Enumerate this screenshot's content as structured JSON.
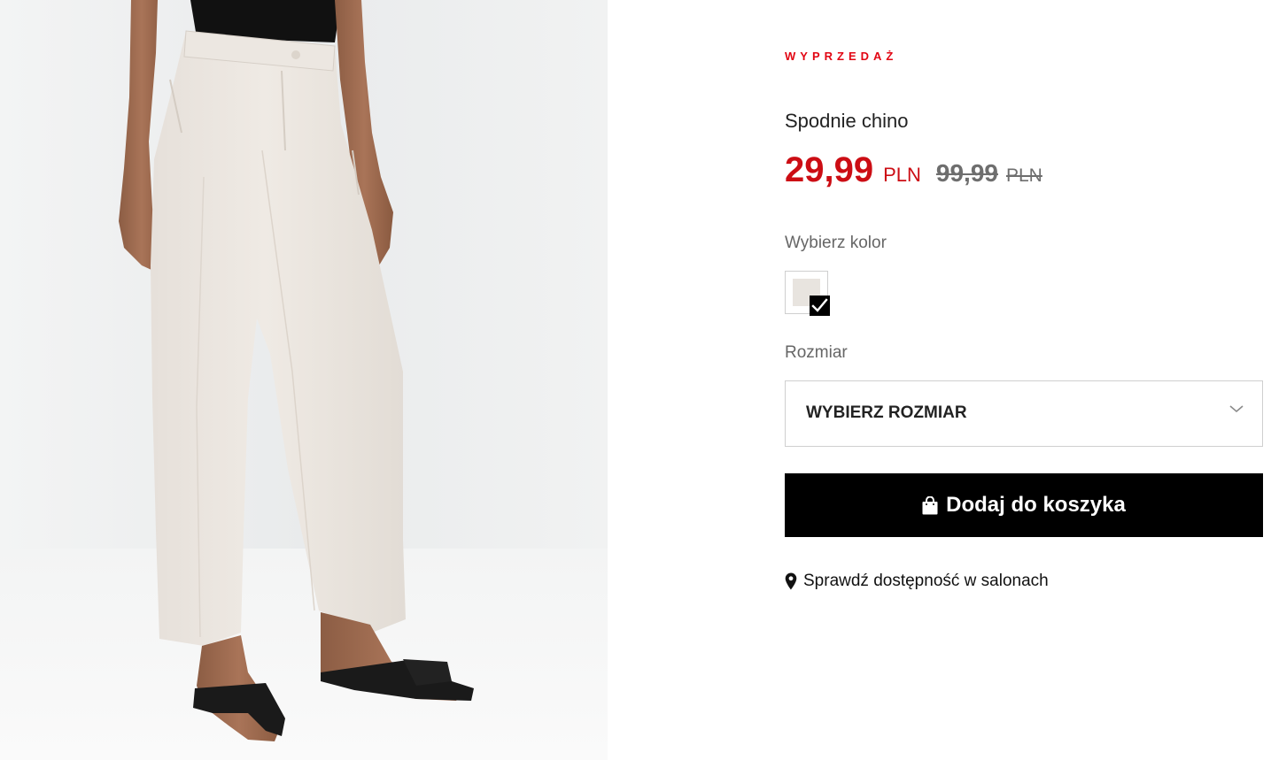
{
  "product": {
    "badge": "WYPRZEDAŻ",
    "name": "Spodnie chino",
    "price": {
      "current": "29,99",
      "current_currency": "PLN",
      "old": "99,99",
      "old_currency": "PLN"
    },
    "color_section": {
      "label": "Wybierz kolor",
      "selected_color": "#e8e4df",
      "icon": "check-icon"
    },
    "size_section": {
      "label": "Rozmiar",
      "select_value": "WYBIERZ ROZMIAR",
      "icon": "chevron-down-icon"
    },
    "add_to_cart": {
      "label": "Dodaj do koszyka",
      "icon": "shopping-bag-icon"
    },
    "store_availability": {
      "label": "Sprawdź dostępność w salonach",
      "icon": "map-pin-icon"
    }
  },
  "colors": {
    "sale_red": "#e20613",
    "price_red": "#cc0d14",
    "old_price_gray": "#6e6e6e",
    "button_black": "#000000"
  }
}
